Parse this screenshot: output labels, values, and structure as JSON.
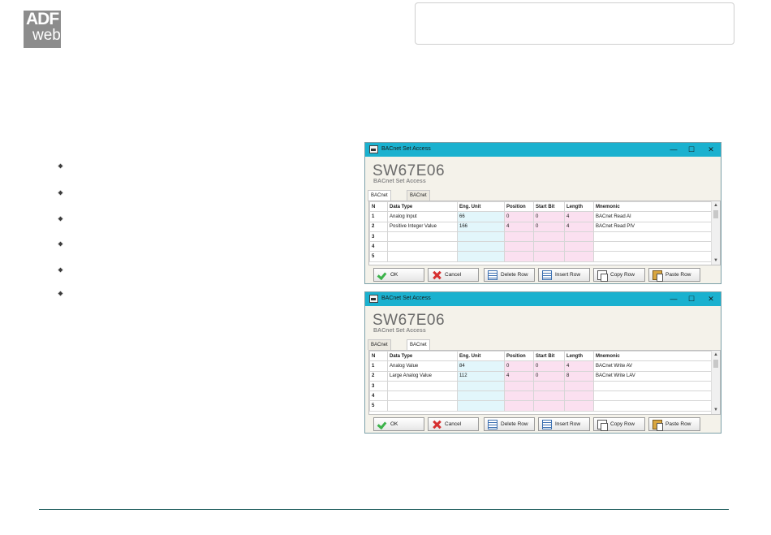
{
  "logo": {
    "line1": "ADF",
    "line2": "web"
  },
  "windows": [
    {
      "title": "BACnet Set Access",
      "big_title": "SW67E06",
      "subtitle": "BACnet Set Access",
      "controls": {
        "minimize": "—",
        "maximize": "☐",
        "close": "✕"
      },
      "tabs": [
        {
          "label": "BACnet in Read",
          "active": true
        },
        {
          "label": "BACnet in Write",
          "active": false
        }
      ],
      "columns": [
        "N",
        "Data Type",
        "Eng. Unit",
        "Position",
        "Start Bit",
        "Length",
        "Mnemonic"
      ],
      "rows": [
        [
          "1",
          "Analog Input",
          "66",
          "0",
          "0",
          "4",
          "BACnet Read AI"
        ],
        [
          "2",
          "Positive Integer Value",
          "166",
          "4",
          "0",
          "4",
          "BACnet Read PIV"
        ],
        [
          "3",
          "",
          "",
          "",
          "",
          "",
          ""
        ],
        [
          "4",
          "",
          "",
          "",
          "",
          "",
          ""
        ],
        [
          "5",
          "",
          "",
          "",
          "",
          "",
          ""
        ]
      ],
      "buttons": {
        "ok": "OK",
        "cancel": "Cancel",
        "delete_row": "Delete Row",
        "insert_row": "Insert Row",
        "copy_row": "Copy Row",
        "paste_row": "Paste Row"
      },
      "scroll": {
        "up": "▲",
        "down": "▼"
      }
    },
    {
      "title": "BACnet Set Access",
      "big_title": "SW67E06",
      "subtitle": "BACnet Set Access",
      "controls": {
        "minimize": "—",
        "maximize": "☐",
        "close": "✕"
      },
      "tabs": [
        {
          "label": "BACnet in Read",
          "active": false
        },
        {
          "label": "BACnet in Write",
          "active": true
        }
      ],
      "columns": [
        "N",
        "Data Type",
        "Eng. Unit",
        "Position",
        "Start Bit",
        "Length",
        "Mnemonic"
      ],
      "rows": [
        [
          "1",
          "Analog Value",
          "84",
          "0",
          "0",
          "4",
          "BACnet Write AV"
        ],
        [
          "2",
          "Large Analog Value",
          "112",
          "4",
          "0",
          "8",
          "BACnet Write LAV"
        ],
        [
          "3",
          "",
          "",
          "",
          "",
          "",
          ""
        ],
        [
          "4",
          "",
          "",
          "",
          "",
          "",
          ""
        ],
        [
          "5",
          "",
          "",
          "",
          "",
          "",
          ""
        ]
      ],
      "buttons": {
        "ok": "OK",
        "cancel": "Cancel",
        "delete_row": "Delete Row",
        "insert_row": "Insert Row",
        "copy_row": "Copy Row",
        "paste_row": "Paste Row"
      },
      "scroll": {
        "up": "▲",
        "down": "▼"
      }
    }
  ],
  "bullet_icon": "diamond-bullet-icon",
  "colors": {
    "titlebar": "#1ab1cf",
    "eng_unit_cell": "#e2f6fb",
    "position_cell": "#fbe0f0",
    "footer_line": "#1a5a5a"
  }
}
